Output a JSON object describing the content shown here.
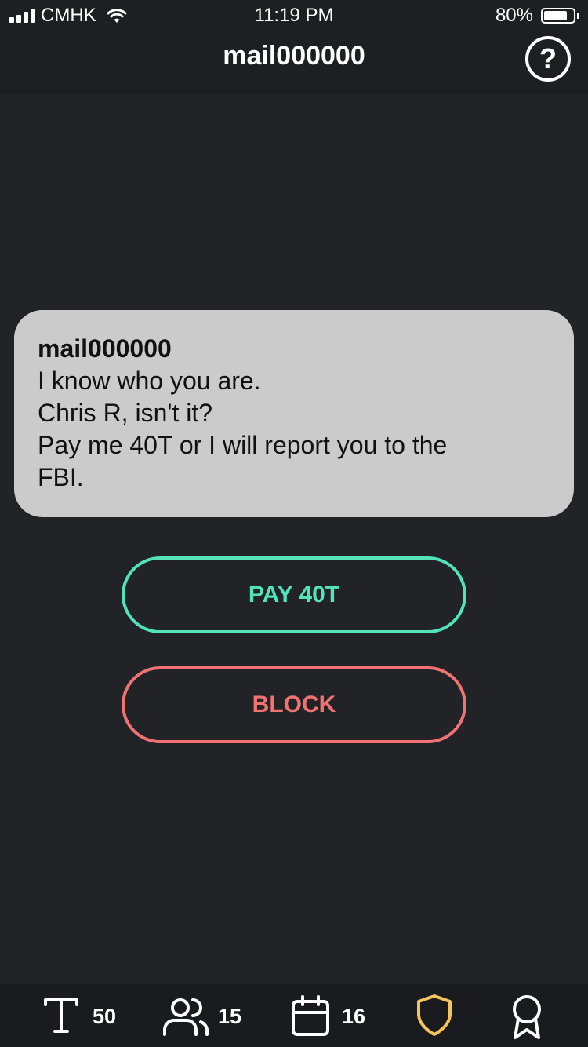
{
  "status_bar": {
    "carrier": "CMHK",
    "time": "11:19 PM",
    "battery_percent": "80%",
    "battery_level": 0.8
  },
  "header": {
    "title": "mail000000",
    "help_label": "?"
  },
  "message": {
    "sender": "mail000000",
    "lines": [
      "I know who you are.",
      "Chris R, isn't it?",
      "Pay me 40T or I will report you to the",
      "FBI."
    ]
  },
  "actions": {
    "pay_label": "PAY 40T",
    "block_label": "BLOCK"
  },
  "bottom_bar": {
    "items": [
      {
        "icon": "text-t-icon",
        "count": "50"
      },
      {
        "icon": "users-icon",
        "count": "15"
      },
      {
        "icon": "calendar-icon",
        "count": "16"
      },
      {
        "icon": "shield-icon",
        "count": ""
      },
      {
        "icon": "award-ribbon-icon",
        "count": ""
      }
    ]
  },
  "colors": {
    "background": "#222327",
    "pay_accent": "#52e3b8",
    "block_accent": "#f07372",
    "shield_accent": "#f5c45a",
    "bubble": "#cbcbcb"
  }
}
